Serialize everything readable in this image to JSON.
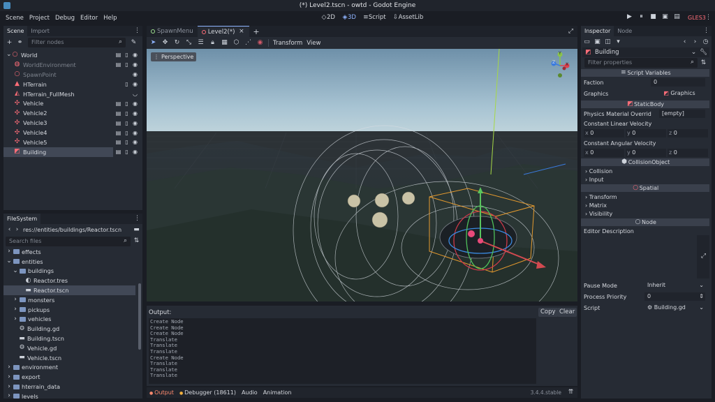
{
  "window": {
    "title": "(*) Level2.tscn - owtd - Godot Engine"
  },
  "menu": {
    "items": [
      "Scene",
      "Project",
      "Debug",
      "Editor",
      "Help"
    ]
  },
  "workspaces": {
    "mode_2d": "2D",
    "mode_3d": "3D",
    "script": "Script",
    "assetlib": "AssetLib"
  },
  "renderer": "GLES3",
  "scene_dock": {
    "tabs": [
      "Scene",
      "Import"
    ],
    "filter_placeholder": "Filter nodes",
    "nodes": [
      {
        "label": "World",
        "icon": "node3d-icon",
        "depth": 0,
        "dim": false,
        "icons": [
          "film-icon",
          "script-icon",
          "eye-icon"
        ]
      },
      {
        "label": "WorldEnvironment",
        "icon": "environment-icon",
        "depth": 1,
        "dim": true,
        "icons": [
          "film-icon",
          "script-icon",
          "eye-icon"
        ]
      },
      {
        "label": "SpawnPoint",
        "icon": "position3d-icon",
        "depth": 1,
        "dim": true,
        "icons": [
          "eye-icon"
        ]
      },
      {
        "label": "HTerrain",
        "icon": "terrain-icon",
        "depth": 1,
        "dim": false,
        "icons": [
          "script-icon",
          "eye-icon"
        ]
      },
      {
        "label": "HTerrain_FullMesh",
        "icon": "mesh-icon",
        "depth": 1,
        "dim": false,
        "icons": [
          "eye-closed-icon"
        ]
      },
      {
        "label": "Vehicle",
        "icon": "vehicle-icon",
        "depth": 1,
        "dim": false,
        "icons": [
          "film-icon",
          "script-icon",
          "eye-icon"
        ]
      },
      {
        "label": "Vehicle2",
        "icon": "vehicle-icon",
        "depth": 1,
        "dim": false,
        "icons": [
          "film-icon",
          "script-icon",
          "eye-icon"
        ]
      },
      {
        "label": "Vehicle3",
        "icon": "vehicle-icon",
        "depth": 1,
        "dim": false,
        "icons": [
          "film-icon",
          "script-icon",
          "eye-icon"
        ]
      },
      {
        "label": "Vehicle4",
        "icon": "vehicle-icon",
        "depth": 1,
        "dim": false,
        "icons": [
          "film-icon",
          "script-icon",
          "eye-icon"
        ]
      },
      {
        "label": "Vehicle5",
        "icon": "vehicle-icon",
        "depth": 1,
        "dim": false,
        "icons": [
          "film-icon",
          "script-icon",
          "eye-icon"
        ]
      },
      {
        "label": "Building",
        "icon": "staticbody-icon",
        "depth": 1,
        "dim": false,
        "selected": true,
        "icons": [
          "film-icon",
          "script-icon",
          "eye-icon"
        ]
      }
    ]
  },
  "filesystem": {
    "tab": "FileSystem",
    "path": "res://entities/buildings/Reactor.tscn",
    "search_placeholder": "Search files",
    "items": [
      {
        "label": "effects",
        "type": "folder",
        "depth": 1,
        "arrow": "right"
      },
      {
        "label": "entities",
        "type": "folder",
        "depth": 1,
        "arrow": "down"
      },
      {
        "label": "buildings",
        "type": "folder",
        "depth": 2,
        "arrow": "down"
      },
      {
        "label": "Reactor.tres",
        "type": "resource",
        "depth": 3,
        "arrow": ""
      },
      {
        "label": "Reactor.tscn",
        "type": "scene",
        "depth": 3,
        "arrow": "",
        "selected": true
      },
      {
        "label": "monsters",
        "type": "folder",
        "depth": 2,
        "arrow": "right"
      },
      {
        "label": "pickups",
        "type": "folder",
        "depth": 2,
        "arrow": "right"
      },
      {
        "label": "vehicles",
        "type": "folder",
        "depth": 2,
        "arrow": "right"
      },
      {
        "label": "Building.gd",
        "type": "script",
        "depth": 2,
        "arrow": ""
      },
      {
        "label": "Building.tscn",
        "type": "scene",
        "depth": 2,
        "arrow": ""
      },
      {
        "label": "Vehicle.gd",
        "type": "script",
        "depth": 2,
        "arrow": ""
      },
      {
        "label": "Vehicle.tscn",
        "type": "scene",
        "depth": 2,
        "arrow": ""
      },
      {
        "label": "environment",
        "type": "folder",
        "depth": 1,
        "arrow": "right"
      },
      {
        "label": "export",
        "type": "folder",
        "depth": 1,
        "arrow": "right"
      },
      {
        "label": "hterrain_data",
        "type": "folder",
        "depth": 1,
        "arrow": "right"
      },
      {
        "label": "levels",
        "type": "folder",
        "depth": 1,
        "arrow": "right"
      }
    ]
  },
  "editor_tabs": [
    {
      "label": "SpawnMenu",
      "active": false
    },
    {
      "label": "Level2(*)",
      "active": true
    }
  ],
  "toolbar3d": {
    "transform": "Transform",
    "view": "View"
  },
  "viewport": {
    "perspective": "Perspective",
    "gizmo": {
      "y": "Y",
      "z": "Z",
      "x": "X"
    }
  },
  "output": {
    "title": "Output:",
    "copy": "Copy",
    "clear": "Clear",
    "lines": [
      "Create Node",
      "Create Node",
      "Create Node",
      "Translate",
      "Translate",
      "Translate",
      "Create Node",
      "Translate",
      "Translate",
      "Translate"
    ]
  },
  "bottom_tabs": [
    {
      "label": "Output",
      "active": true
    },
    {
      "label": "Debugger (18611)",
      "active": false
    },
    {
      "label": "Audio",
      "active": false
    },
    {
      "label": "Animation",
      "active": false
    }
  ],
  "version": "3.4.4.stable",
  "inspector": {
    "tabs": [
      "Inspector",
      "Node"
    ],
    "object": "Building",
    "filter_placeholder": "Filter properties",
    "script_variables": "Script Variables",
    "faction_label": "Faction",
    "faction_value": "0",
    "graphics_label": "Graphics",
    "graphics_value": "Graphics",
    "staticbody": "StaticBody",
    "phys_mat_label": "Physics Material Overrid",
    "phys_mat_value": "[empty]",
    "lin_vel_label": "Constant Linear Velocity",
    "lin_vel": {
      "x": "0",
      "y": "0",
      "z": "0"
    },
    "ang_vel_label": "Constant Angular Velocity",
    "ang_vel": {
      "x": "0",
      "y": "0",
      "z": "0"
    },
    "collision_object": "CollisionObject",
    "collision": "Collision",
    "input": "Input",
    "spatial": "Spatial",
    "transform": "Transform",
    "matrix": "Matrix",
    "visibility": "Visibility",
    "node": "Node",
    "editor_description": "Editor Description",
    "pause_label": "Pause Mode",
    "pause_value": "Inherit",
    "priority_label": "Process Priority",
    "priority_value": "0",
    "script_label": "Script",
    "script_value": "Building.gd"
  },
  "colors": {
    "accent": "#8fb4ff",
    "selected": "#414856",
    "panel": "#262b34",
    "gles3": "#ff6d78"
  }
}
